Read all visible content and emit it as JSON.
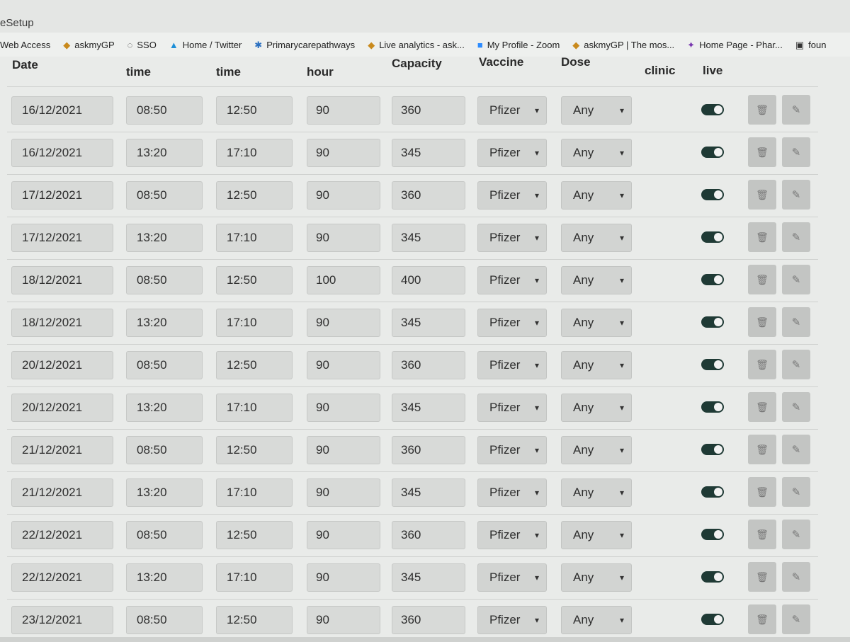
{
  "window": {
    "title": "eSetup"
  },
  "bookmarks": [
    {
      "label": "Web Access",
      "icon": "none"
    },
    {
      "label": "askmyGP",
      "icon": "askmygp-icon"
    },
    {
      "label": "SSO",
      "icon": "sso-icon"
    },
    {
      "label": "Home / Twitter",
      "icon": "twitter-icon"
    },
    {
      "label": "Primarycarepathways",
      "icon": "pathways-icon"
    },
    {
      "label": "Live analytics - ask...",
      "icon": "askmygp-icon"
    },
    {
      "label": "My Profile - Zoom",
      "icon": "zoom-icon"
    },
    {
      "label": "askmyGP | The mos...",
      "icon": "askmygp-icon"
    },
    {
      "label": "Home Page - Phar...",
      "icon": "pharmacy-icon"
    },
    {
      "label": "foun",
      "icon": "page-icon"
    }
  ],
  "table": {
    "headers": {
      "date": "Date",
      "start_time": "time",
      "end_time": "time",
      "per_hour": "hour",
      "capacity": "Capacity",
      "vaccine": "Vaccine",
      "dose": "Dose",
      "clinic": "clinic",
      "live": "live"
    },
    "rows": [
      {
        "date": "16/12/2021",
        "start": "08:50",
        "end": "12:50",
        "per_hour": "90",
        "capacity": "360",
        "vaccine": "Pfizer",
        "dose": "Any",
        "live": true
      },
      {
        "date": "16/12/2021",
        "start": "13:20",
        "end": "17:10",
        "per_hour": "90",
        "capacity": "345",
        "vaccine": "Pfizer",
        "dose": "Any",
        "live": true
      },
      {
        "date": "17/12/2021",
        "start": "08:50",
        "end": "12:50",
        "per_hour": "90",
        "capacity": "360",
        "vaccine": "Pfizer",
        "dose": "Any",
        "live": true
      },
      {
        "date": "17/12/2021",
        "start": "13:20",
        "end": "17:10",
        "per_hour": "90",
        "capacity": "345",
        "vaccine": "Pfizer",
        "dose": "Any",
        "live": true
      },
      {
        "date": "18/12/2021",
        "start": "08:50",
        "end": "12:50",
        "per_hour": "100",
        "capacity": "400",
        "vaccine": "Pfizer",
        "dose": "Any",
        "live": true
      },
      {
        "date": "18/12/2021",
        "start": "13:20",
        "end": "17:10",
        "per_hour": "90",
        "capacity": "345",
        "vaccine": "Pfizer",
        "dose": "Any",
        "live": true
      },
      {
        "date": "20/12/2021",
        "start": "08:50",
        "end": "12:50",
        "per_hour": "90",
        "capacity": "360",
        "vaccine": "Pfizer",
        "dose": "Any",
        "live": true
      },
      {
        "date": "20/12/2021",
        "start": "13:20",
        "end": "17:10",
        "per_hour": "90",
        "capacity": "345",
        "vaccine": "Pfizer",
        "dose": "Any",
        "live": true
      },
      {
        "date": "21/12/2021",
        "start": "08:50",
        "end": "12:50",
        "per_hour": "90",
        "capacity": "360",
        "vaccine": "Pfizer",
        "dose": "Any",
        "live": true
      },
      {
        "date": "21/12/2021",
        "start": "13:20",
        "end": "17:10",
        "per_hour": "90",
        "capacity": "345",
        "vaccine": "Pfizer",
        "dose": "Any",
        "live": true
      },
      {
        "date": "22/12/2021",
        "start": "08:50",
        "end": "12:50",
        "per_hour": "90",
        "capacity": "360",
        "vaccine": "Pfizer",
        "dose": "Any",
        "live": true
      },
      {
        "date": "22/12/2021",
        "start": "13:20",
        "end": "17:10",
        "per_hour": "90",
        "capacity": "345",
        "vaccine": "Pfizer",
        "dose": "Any",
        "live": true
      },
      {
        "date": "23/12/2021",
        "start": "08:50",
        "end": "12:50",
        "per_hour": "90",
        "capacity": "360",
        "vaccine": "Pfizer",
        "dose": "Any",
        "live": true
      }
    ]
  },
  "icons": {
    "delete": "trash-icon",
    "edit": "pencil-icon",
    "select": "chevron-down-icon"
  },
  "colors": {
    "toggle_on": "#1f3a35",
    "field_bg": "#d8dad8",
    "action_bg": "#c3c5c3"
  }
}
